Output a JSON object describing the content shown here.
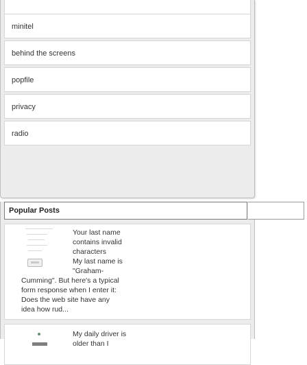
{
  "categories": {
    "items": [
      {
        "label": "minitel"
      },
      {
        "label": "behind the screens"
      },
      {
        "label": "popfile"
      },
      {
        "label": "privacy"
      },
      {
        "label": "radio"
      }
    ]
  },
  "popular_posts": {
    "title": "Popular Posts",
    "posts": [
      {
        "excerpt_lines": [
          "Your last name",
          "contains invalid",
          "characters",
          "My last name is",
          "\"Graham-",
          "Cumming\". But here's a typical",
          "form response when I enter it:",
          "Does the web site have any",
          "idea how rud..."
        ]
      },
      {
        "excerpt_lines": [
          "My daily driver is",
          "older than I"
        ]
      }
    ]
  },
  "colors": {
    "widget_bg": "#ececec",
    "card_bg": "#ffffff",
    "border": "#d6d6d6",
    "text": "#333333"
  }
}
